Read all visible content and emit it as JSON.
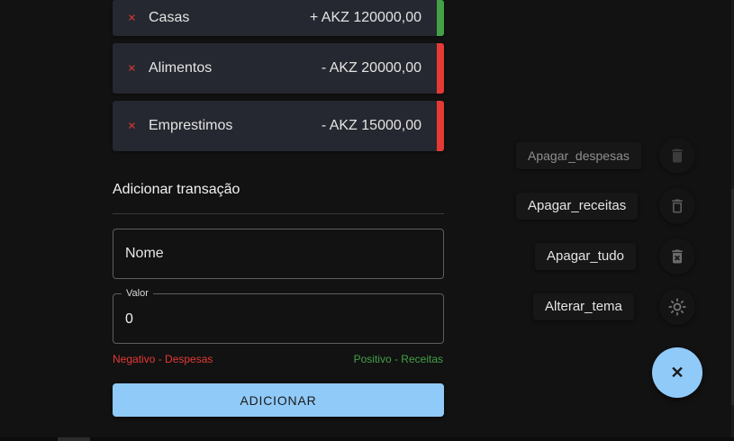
{
  "transactions": [
    {
      "name": "Casas",
      "amount": "+ AKZ 120000,00",
      "type": "income",
      "delete_icon": "×"
    },
    {
      "name": "Alimentos",
      "amount": "- AKZ 20000,00",
      "type": "expense",
      "delete_icon": "×"
    },
    {
      "name": "Emprestimos",
      "amount": "- AKZ 15000,00",
      "type": "expense",
      "delete_icon": "×"
    }
  ],
  "form": {
    "title": "Adicionar transação",
    "name_placeholder": "Nome",
    "name_value": "",
    "value_label": "Valor",
    "value_value": "0",
    "hint_negative": "Negativo - Despesas",
    "hint_positive": "Positivo - Receitas",
    "submit_label": "ADICIONAR"
  },
  "speed_dial": {
    "actions": [
      {
        "label": "Apagar_despesas",
        "icon": "delete-icon"
      },
      {
        "label": "Apagar_receitas",
        "icon": "delete-outline-icon"
      },
      {
        "label": "Apagar_tudo",
        "icon": "delete-forever-icon"
      },
      {
        "label": "Alterar_tema",
        "icon": "brightness-icon"
      }
    ],
    "fab_icon": "✕"
  },
  "colors": {
    "income": "#43a047",
    "expense": "#e53935",
    "accent": "#90caf9",
    "background": "#121212",
    "card": "#252830"
  }
}
